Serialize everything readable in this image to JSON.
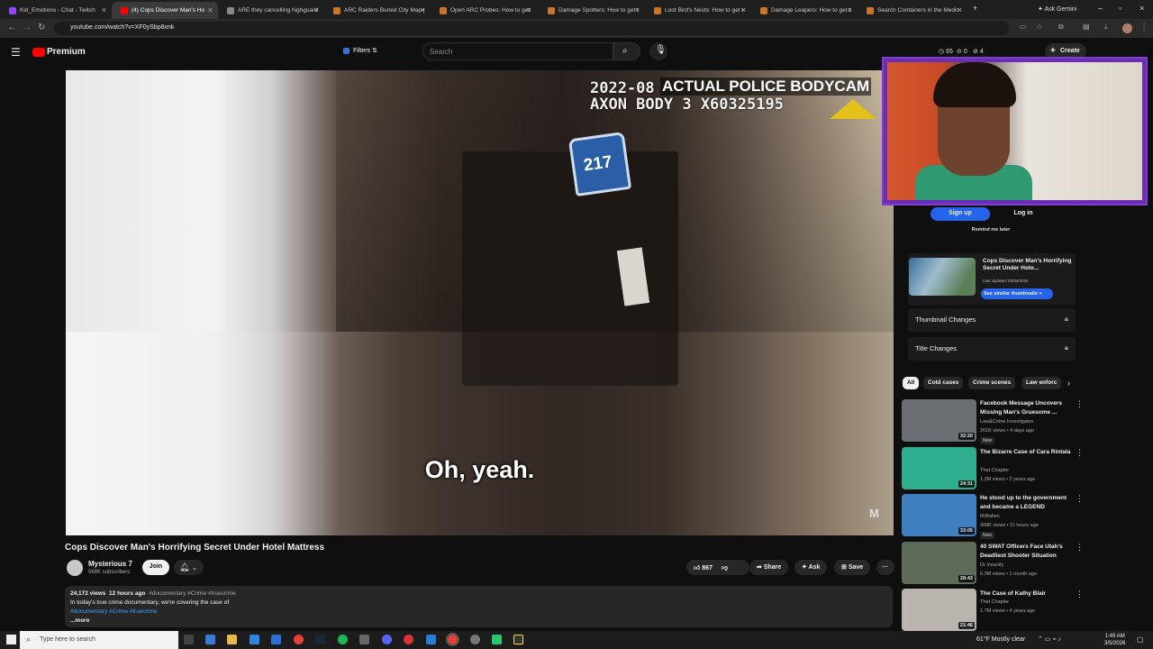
{
  "browser": {
    "tabs": [
      {
        "title": "Kid_Emotions - Chat - Twitch",
        "color": "#9146ff"
      },
      {
        "title": "(4) Cops Discover Man's Ho",
        "color": "#ff0000"
      },
      {
        "title": "ARE they cancelling highguard",
        "color": "#888888"
      },
      {
        "title": "ARC Raiders Buried City Map |",
        "color": "#c9762a"
      },
      {
        "title": "Open ARC Probes: How to get",
        "color": "#c9762a"
      },
      {
        "title": "Damage Spotters: How to get t",
        "color": "#c9762a"
      },
      {
        "title": "Loot Bird's Nests: How to get t",
        "color": "#c9762a"
      },
      {
        "title": "Damage Leapers: How to get t",
        "color": "#c9762a"
      },
      {
        "title": "Search Containers in the Medic",
        "color": "#c9762a"
      }
    ],
    "ask_gemini": "Ask Gemini",
    "url": "youtube.com/watch?v=XF0ySbp8xnk"
  },
  "youtube": {
    "logo": "Premium",
    "filters": "Filters",
    "search_placeholder": "Search",
    "create": "Create",
    "header_counts": [
      "65",
      "0",
      "4"
    ]
  },
  "video": {
    "osd_line1": "2022-08",
    "osd_line2": "AXON BODY 3  X60325195",
    "banner": "ACTUAL POLICE BODYCAM",
    "room_number": "217",
    "subtitle": "Oh, yeah.",
    "watermark": "M"
  },
  "below_video": {
    "title": "Cops Discover Man's Horrifying Secret Under Hotel Mattress",
    "channel": "Mysterious 7",
    "subscribers": "568K subscribers",
    "join": "Join",
    "likes": "867",
    "share": "Share",
    "ask": "Ask",
    "save": "Save",
    "views": "24,172 views",
    "age": "12 hours ago",
    "tags": "#documentary #Crime #truecrime",
    "desc_line": "In today's true crime documentary, we're covering the case of",
    "desc_tags": "#documentary #Crime #truecrime",
    "more": "...more"
  },
  "extension": {
    "signup": "Sign up",
    "login": "Log in",
    "remind": "Remind me later",
    "card_title": "Cops Discover Man's Horrifying Secret Under Hote...",
    "card_updated": "Last Updated 03/04/2026",
    "similar": "See similar thumbnails",
    "rows": [
      "Thumbnail Changes",
      "Title Changes"
    ]
  },
  "chips": [
    "All",
    "Cold cases",
    "Crime scenes",
    "Law enforc"
  ],
  "related": [
    {
      "title": "Facebook Message Uncovers Missing Man's Gruesome ...",
      "channel": "Law&Crime Investigates",
      "meta": "261K views • 4 days ago",
      "badge": "New",
      "duration": "32:20",
      "color": "#6b6f73"
    },
    {
      "title": "The Bizarre Case of Cara Rintala",
      "channel": "That Chapter",
      "meta": "1.3M views • 2 years ago",
      "badge": "",
      "duration": "24:31",
      "color": "#2fae8f"
    },
    {
      "title": "He stood up to the government and became a LEGEND",
      "channel": "MrBallen",
      "meta": "308K views • 11 hours ago",
      "badge": "New",
      "duration": "33:05",
      "color": "#3f7fbf"
    },
    {
      "title": "40 SWAT Officers Face Utah's Deadliest Shooter Situation",
      "channel": "Dr Insanity",
      "meta": "6.3M views • 1 month ago",
      "badge": "",
      "duration": "28:43",
      "color": "#5d6b58"
    },
    {
      "title": "The Case of Kathy Blair",
      "channel": "That Chapter",
      "meta": "1.7M views • 4 years ago",
      "badge": "",
      "duration": "21:46",
      "color": "#b9b4ae"
    }
  ],
  "taskbar": {
    "search_placeholder": "Type here to search",
    "weather": "61°F  Mostly clear",
    "time": "1:49 AM",
    "date": "3/5/2026"
  }
}
